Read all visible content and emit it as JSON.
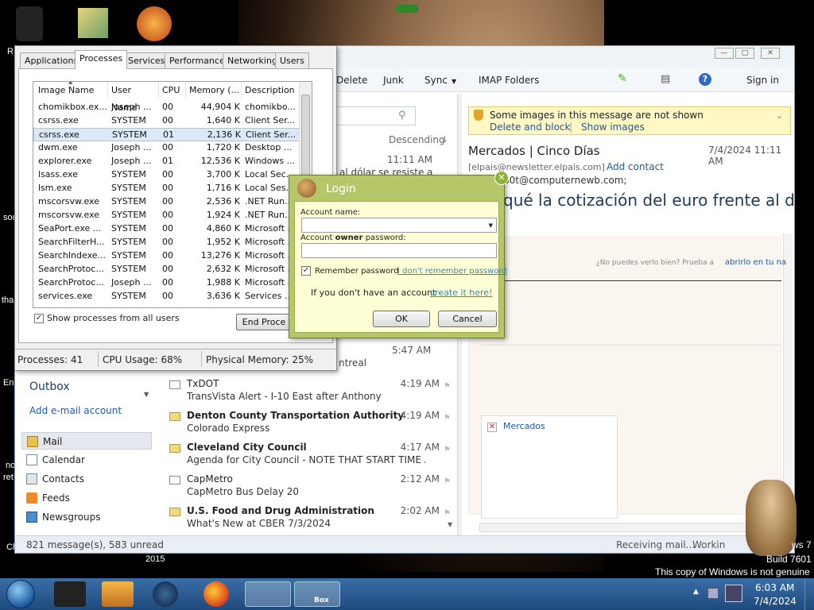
{
  "desktop": {
    "frag_r": "R",
    "frag_sou": "sou",
    "frag_tha": "tha",
    "frag_en": "En",
    "frag_no": "no",
    "frag_ret": "ret",
    "frag_ci": "Cl",
    "frag_2015": "2015",
    "watermark_line1": "ws 7",
    "watermark_line2": "Build 7601",
    "watermark_line3": "This copy of Windows is not genuine"
  },
  "mail": {
    "toolbar": {
      "delete": "Delete",
      "junk": "Junk",
      "sync": "Sync",
      "imap": "IMAP Folders",
      "signin": "Sign in"
    },
    "list_header": {
      "sort": "Descending"
    },
    "nav": {
      "outbox": "Outbox",
      "add_account": "Add e-mail account",
      "items": [
        "Mail",
        "Calendar",
        "Contacts",
        "Feeds",
        "Newsgroups"
      ]
    },
    "partial_messages": [
      {
        "time": "11:11 AM",
        "subject": "al dólar se resiste a"
      },
      {
        "time": "5:47 AM",
        "subject": "ntreal"
      }
    ],
    "messages": [
      {
        "from": "TxDOT",
        "subject": "TransVista Alert - I-10 East after Anthony",
        "time": "4:19 AM",
        "unread": false
      },
      {
        "from": "Denton County Transportation Authority",
        "subject": "Colorado Express",
        "time": "4:19 AM",
        "unread": true
      },
      {
        "from": "Cleveland City Council",
        "subject": "Agenda for City Council - NOTE THAT START TIME AN...",
        "time": "4:17 AM",
        "unread": true
      },
      {
        "from": "CapMetro",
        "subject": "CapMetro Bus Delay 20",
        "time": "2:12 AM",
        "unread": false
      },
      {
        "from": "U.S. Food and Drug Administration",
        "subject": "What's New at CBER 7/3/2024",
        "time": "2:02 AM",
        "unread": true
      }
    ],
    "reading": {
      "infobar_text": "Some images in this message are not shown",
      "delete_block": "Delete and block",
      "separator": "|",
      "show_images": "Show images",
      "sender_name": "Mercados | Cinco Días",
      "date": "7/4/2024 11:11 AM",
      "sender_email": "[elpais@newsletter.elpais.com]",
      "add_contact": "Add contact",
      "to": "b0t@computernewb.com;",
      "headline": "qué la cotización del euro frente al d",
      "cant_see": "¿No puedes verlo bien? Prueba a",
      "open_link": "abrirlo en tu na",
      "img_alt": "Mercados"
    },
    "status": {
      "count": "821 message(s), 583 unread",
      "receiving": "Receiving mail...",
      "working": "Workin"
    }
  },
  "taskmgr": {
    "tabs": [
      "Applications",
      "Processes",
      "Services",
      "Performance",
      "Networking",
      "Users"
    ],
    "columns": [
      "Image Name",
      "User Name",
      "CPU",
      "Memory (...",
      "Description"
    ],
    "rows": [
      [
        "chomikbox.ex...",
        "Joseph ...",
        "00",
        "44,904 K",
        "chomikbo..."
      ],
      [
        "csrss.exe",
        "SYSTEM",
        "00",
        "1,640 K",
        "Client Ser..."
      ],
      [
        "csrss.exe",
        "SYSTEM",
        "01",
        "2,136 K",
        "Client Ser..."
      ],
      [
        "dwm.exe",
        "Joseph ...",
        "00",
        "1,720 K",
        "Desktop ..."
      ],
      [
        "explorer.exe",
        "Joseph ...",
        "01",
        "12,536 K",
        "Windows ..."
      ],
      [
        "lsass.exe",
        "SYSTEM",
        "00",
        "3,700 K",
        "Local Sec..."
      ],
      [
        "lsm.exe",
        "SYSTEM",
        "00",
        "1,716 K",
        "Local Ses..."
      ],
      [
        "mscorsvw.exe",
        "SYSTEM",
        "00",
        "2,536 K",
        ".NET Run..."
      ],
      [
        "mscorsvw.exe",
        "SYSTEM",
        "00",
        "1,924 K",
        ".NET Run..."
      ],
      [
        "SeaPort.exe ...",
        "SYSTEM",
        "00",
        "4,860 K",
        "Microsoft ..."
      ],
      [
        "SearchFilterH...",
        "SYSTEM",
        "00",
        "1,952 K",
        "Microsoft ..."
      ],
      [
        "SearchIndexe...",
        "SYSTEM",
        "00",
        "13,276 K",
        "Microsoft ..."
      ],
      [
        "SearchProtoc...",
        "SYSTEM",
        "00",
        "2,632 K",
        "Microsoft ..."
      ],
      [
        "SearchProtoc...",
        "Joseph ...",
        "00",
        "1,988 K",
        "Microsoft ..."
      ],
      [
        "services.exe",
        "SYSTEM",
        "00",
        "3,636 K",
        "Services ..."
      ]
    ],
    "selected_row": 2,
    "show_all": "Show processes from all users",
    "end_process": "End Proce",
    "status_processes": "Processes: 41",
    "status_cpu": "CPU Usage: 68%",
    "status_memory": "Physical Memory: 25%"
  },
  "login": {
    "title": "Login",
    "account_name_label": "Account name:",
    "password_label_pre": "Account ",
    "password_label_bold": "owner",
    "password_label_post": " password:",
    "remember": "Remember password",
    "forgot": "I don't remember password",
    "no_account": "If you don't have an account -",
    "create": "create it here!",
    "ok": "OK",
    "cancel": "Cancel"
  },
  "taskbar": {
    "box_label": "Box",
    "time": "6:03 AM",
    "date": "7/4/2024"
  }
}
